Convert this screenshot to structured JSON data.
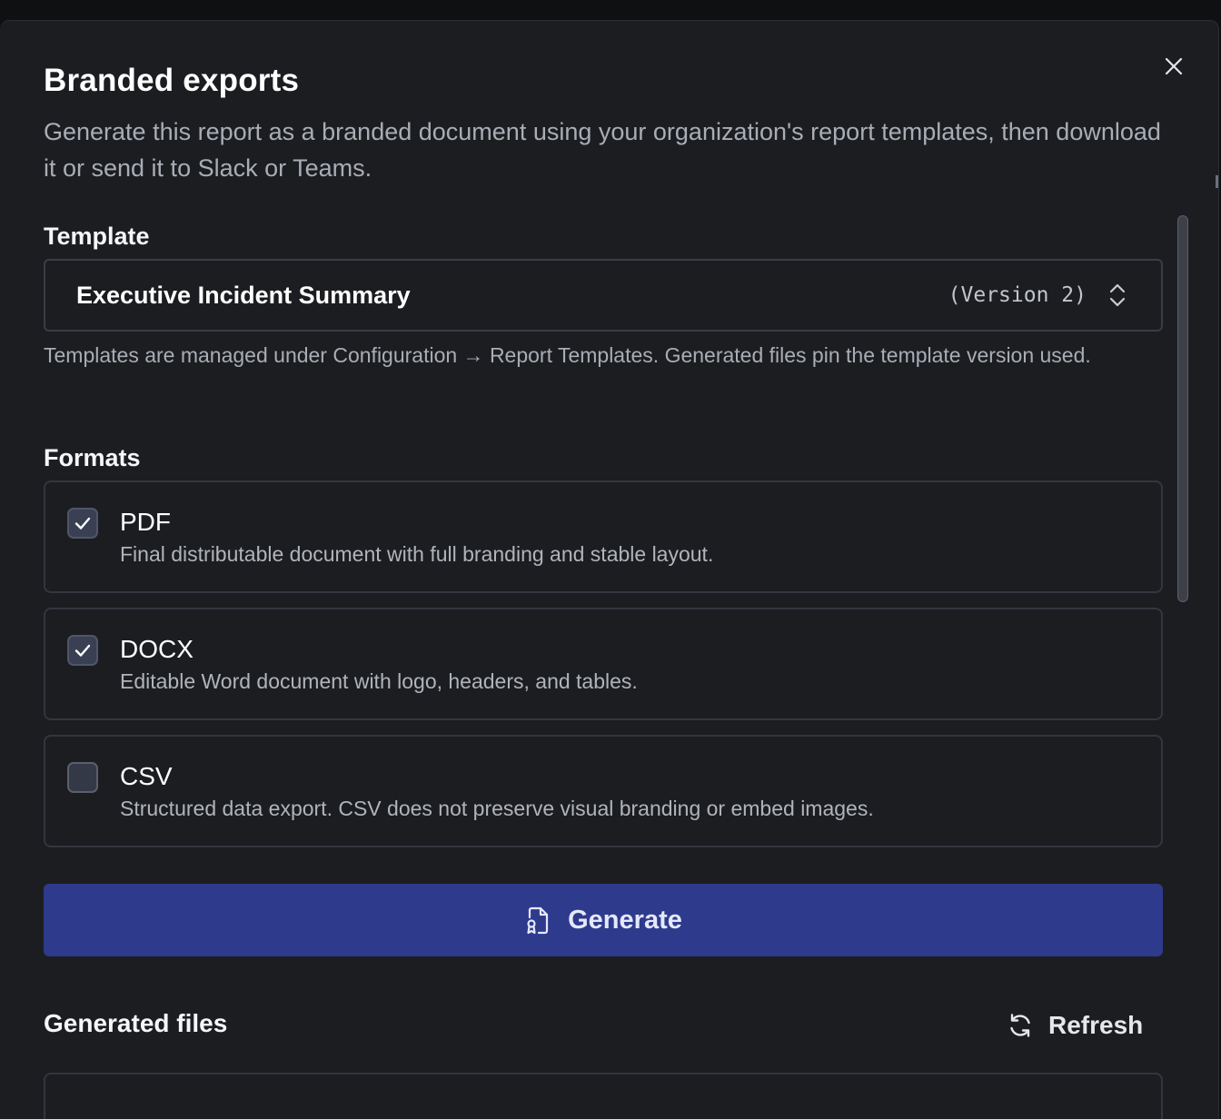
{
  "dialog": {
    "title": "Branded exports",
    "description": "Generate this report as a branded document using your organization's report templates, then download it or send it to Slack or Teams.",
    "close_icon": "close-icon"
  },
  "template": {
    "label": "Template",
    "selected": "Executive Incident Summary",
    "version": "(Version 2)",
    "help": "Templates are managed under Configuration → Report Templates. Generated files pin the template version used."
  },
  "formats": {
    "label": "Formats",
    "items": [
      {
        "name": "PDF",
        "description": "Final distributable document with full branding and stable layout.",
        "checked": true
      },
      {
        "name": "DOCX",
        "description": "Editable Word document with logo, headers, and tables.",
        "checked": true
      },
      {
        "name": "CSV",
        "description": "Structured data export. CSV does not preserve visual branding or embed images.",
        "checked": false
      }
    ]
  },
  "actions": {
    "generate_label": "Generate",
    "generate_icon": "file-badge-icon"
  },
  "generated_files": {
    "title": "Generated files",
    "refresh_label": "Refresh",
    "refresh_icon": "refresh-icon"
  },
  "colors": {
    "background": "#1c1d21",
    "primary": "#2e3a8c",
    "muted_text": "#a9adb5"
  }
}
